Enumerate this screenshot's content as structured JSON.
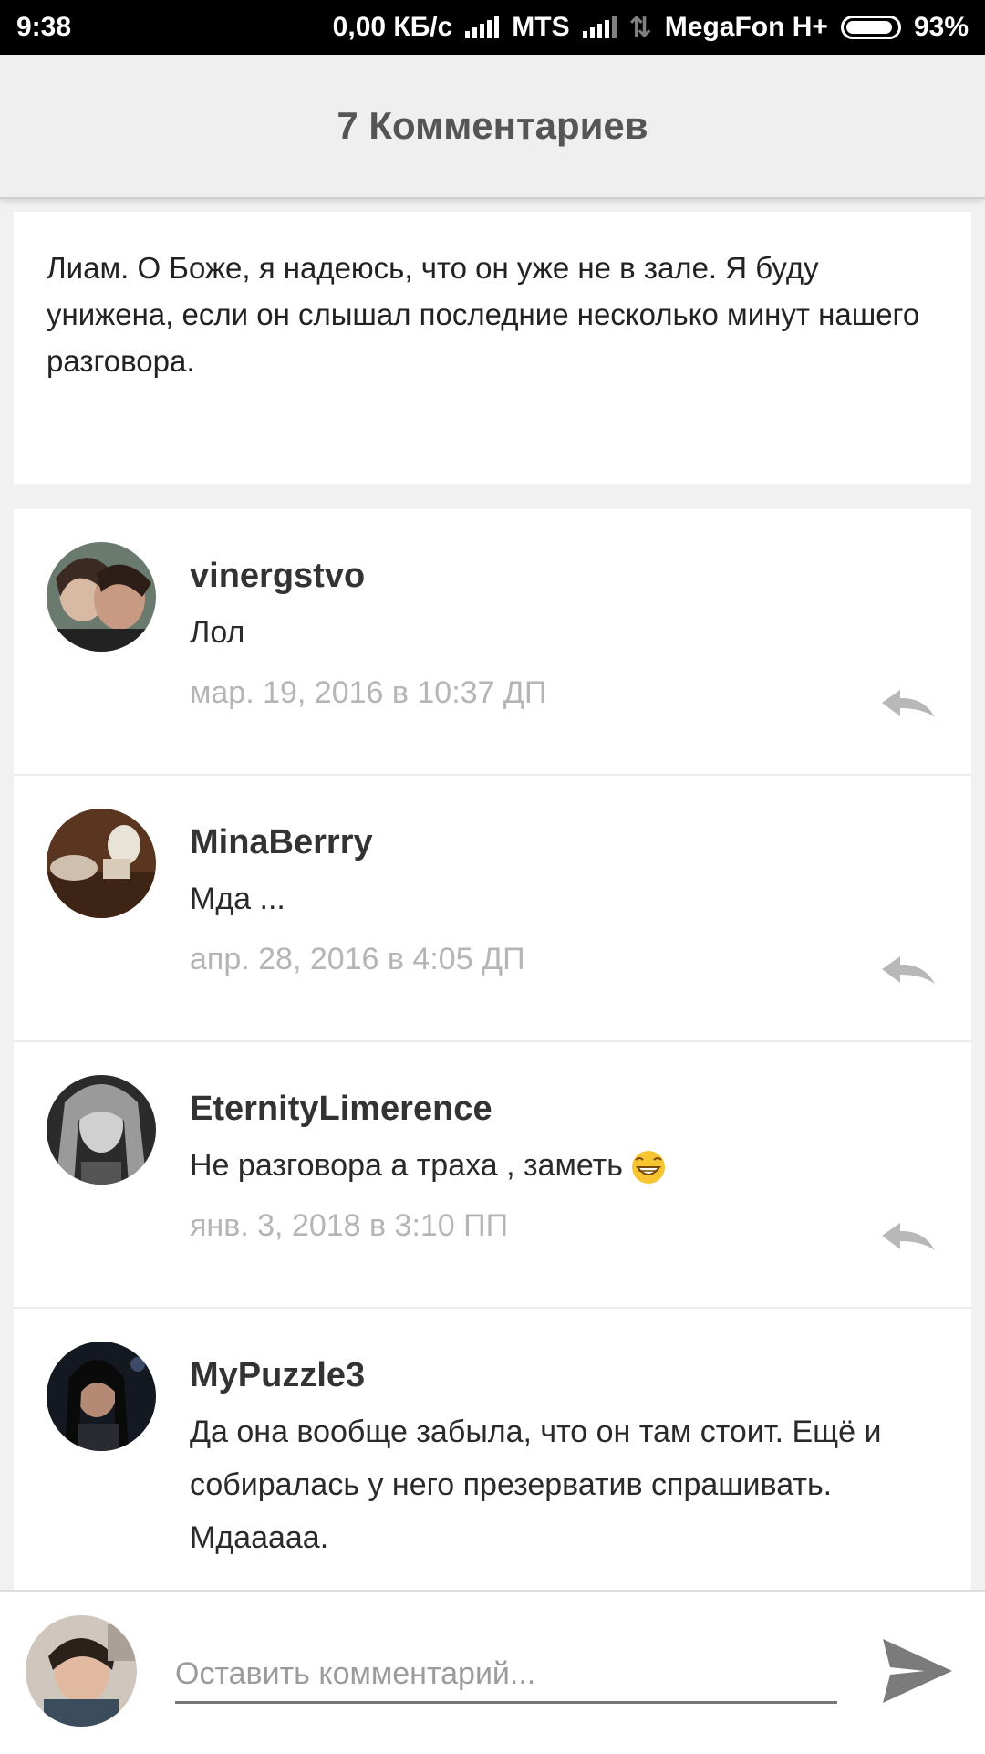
{
  "status_bar": {
    "time": "9:38",
    "speed": "0,00 КБ/с",
    "carrier1": "MTS",
    "carrier2": "MegaFon H+",
    "battery": "93%",
    "battery_level": 0.93
  },
  "header": {
    "title": "7 Комментариев"
  },
  "quote": {
    "text": "Лиам. О Боже, я надеюсь, что он уже не в зале. Я буду унижена, если он слышал последние несколько минут нашего разговора."
  },
  "comments": [
    {
      "user": "vinergstvo",
      "text": "Лол",
      "date": "мар. 19, 2016 в 10:37 ДП"
    },
    {
      "user": "MinaBerrry",
      "text": "Мда ...",
      "date": "апр. 28, 2016 в 4:05 ДП"
    },
    {
      "user": "EternityLimerence",
      "text": "Не разговора а траха , заметь",
      "date": "янв. 3, 2018 в 3:10 ПП"
    },
    {
      "user": "MyPuzzle3",
      "text": "Да она вообще забыла, что он там стоит. Ещё и собиралась у него презерватив спрашивать. Мдааааа.",
      "date": ""
    }
  ],
  "composer": {
    "placeholder": "Оставить комментарий..."
  },
  "colors": {
    "accent_gray": "#555555",
    "date_gray": "#b5b5b5",
    "bg": "#f1f1f1"
  },
  "icons": {
    "reply": "reply-arrow-icon",
    "send": "send-icon",
    "emoji": "grinning-emoji-icon"
  }
}
